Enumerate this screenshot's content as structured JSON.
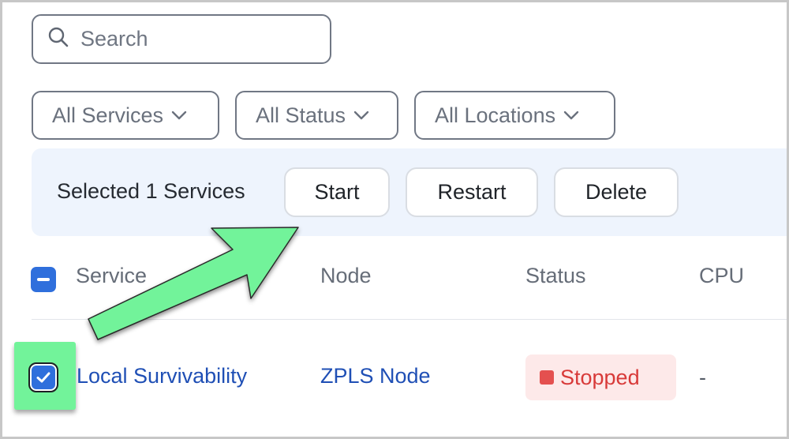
{
  "search": {
    "placeholder": "Search",
    "icon": "search-icon"
  },
  "filters": [
    {
      "label": "All Services",
      "icon": "chevron-down-icon"
    },
    {
      "label": "All Status",
      "icon": "chevron-down-icon"
    },
    {
      "label": "All Locations",
      "icon": "chevron-down-icon"
    }
  ],
  "bulk_bar": {
    "selected_text": "Selected 1 Services",
    "actions": {
      "start": "Start",
      "restart": "Restart",
      "delete": "Delete"
    }
  },
  "table": {
    "columns": {
      "service": "Service",
      "node": "Node",
      "status": "Status",
      "cpu": "CPU"
    },
    "rows": [
      {
        "service": "Local Survivability",
        "node": "ZPLS Node",
        "status": "Stopped",
        "cpu": "-",
        "selected": true
      }
    ]
  },
  "colors": {
    "accent": "#2f6fdc",
    "link": "#1f4fb5",
    "status_stopped_bg": "#fde9e9",
    "status_stopped_text": "#d83a39",
    "annotation_green": "#72f39a",
    "bulk_bar_bg": "#eef4fd"
  }
}
